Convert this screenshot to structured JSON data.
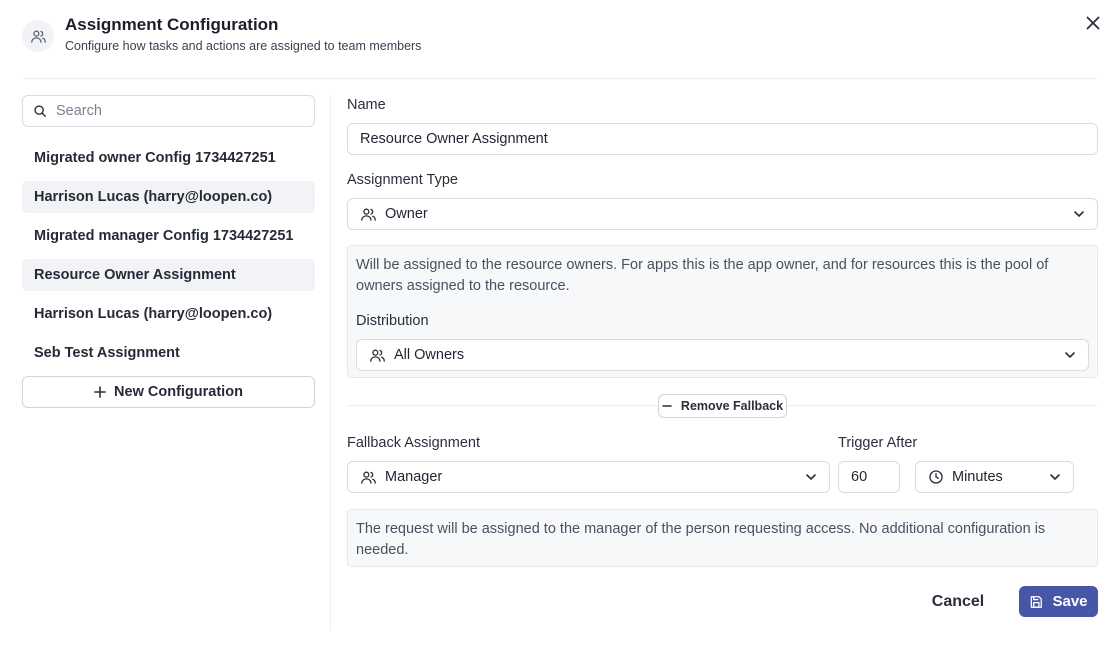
{
  "header": {
    "title": "Assignment Configuration",
    "subtitle": "Configure how tasks and actions are assigned to team members"
  },
  "sidebar": {
    "search_placeholder": "Search",
    "items": [
      {
        "label": "Migrated owner Config 1734427251",
        "shaded": false
      },
      {
        "label": "Harrison Lucas (harry@loopen.co)",
        "shaded": true
      },
      {
        "label": "Migrated manager Config 1734427251",
        "shaded": false
      },
      {
        "label": "Resource Owner Assignment",
        "shaded": true
      },
      {
        "label": "Harrison Lucas (harry@loopen.co)",
        "shaded": false
      },
      {
        "label": "Seb Test Assignment",
        "shaded": false
      }
    ],
    "new_config_label": "New Configuration"
  },
  "form": {
    "name_label": "Name",
    "name_value": "Resource Owner Assignment",
    "type_label": "Assignment Type",
    "type_value": "Owner",
    "type_description": "Will be assigned to the resource owners. For apps this is the app owner, and for resources this is the pool of owners assigned to the resource.",
    "distribution_label": "Distribution",
    "distribution_value": "All Owners",
    "remove_fallback_label": "Remove Fallback",
    "fallback_label": "Fallback Assignment",
    "fallback_value": "Manager",
    "trigger_label": "Trigger After",
    "trigger_value": "60",
    "trigger_unit": "Minutes",
    "fallback_description": "The request will be assigned to the manager of the person requesting access. No additional configuration is needed."
  },
  "footer": {
    "cancel_label": "Cancel",
    "save_label": "Save"
  },
  "colors": {
    "accent": "#4756a6",
    "selected_bg": "#f2f3f6",
    "info_bg": "#f7f8fa"
  }
}
